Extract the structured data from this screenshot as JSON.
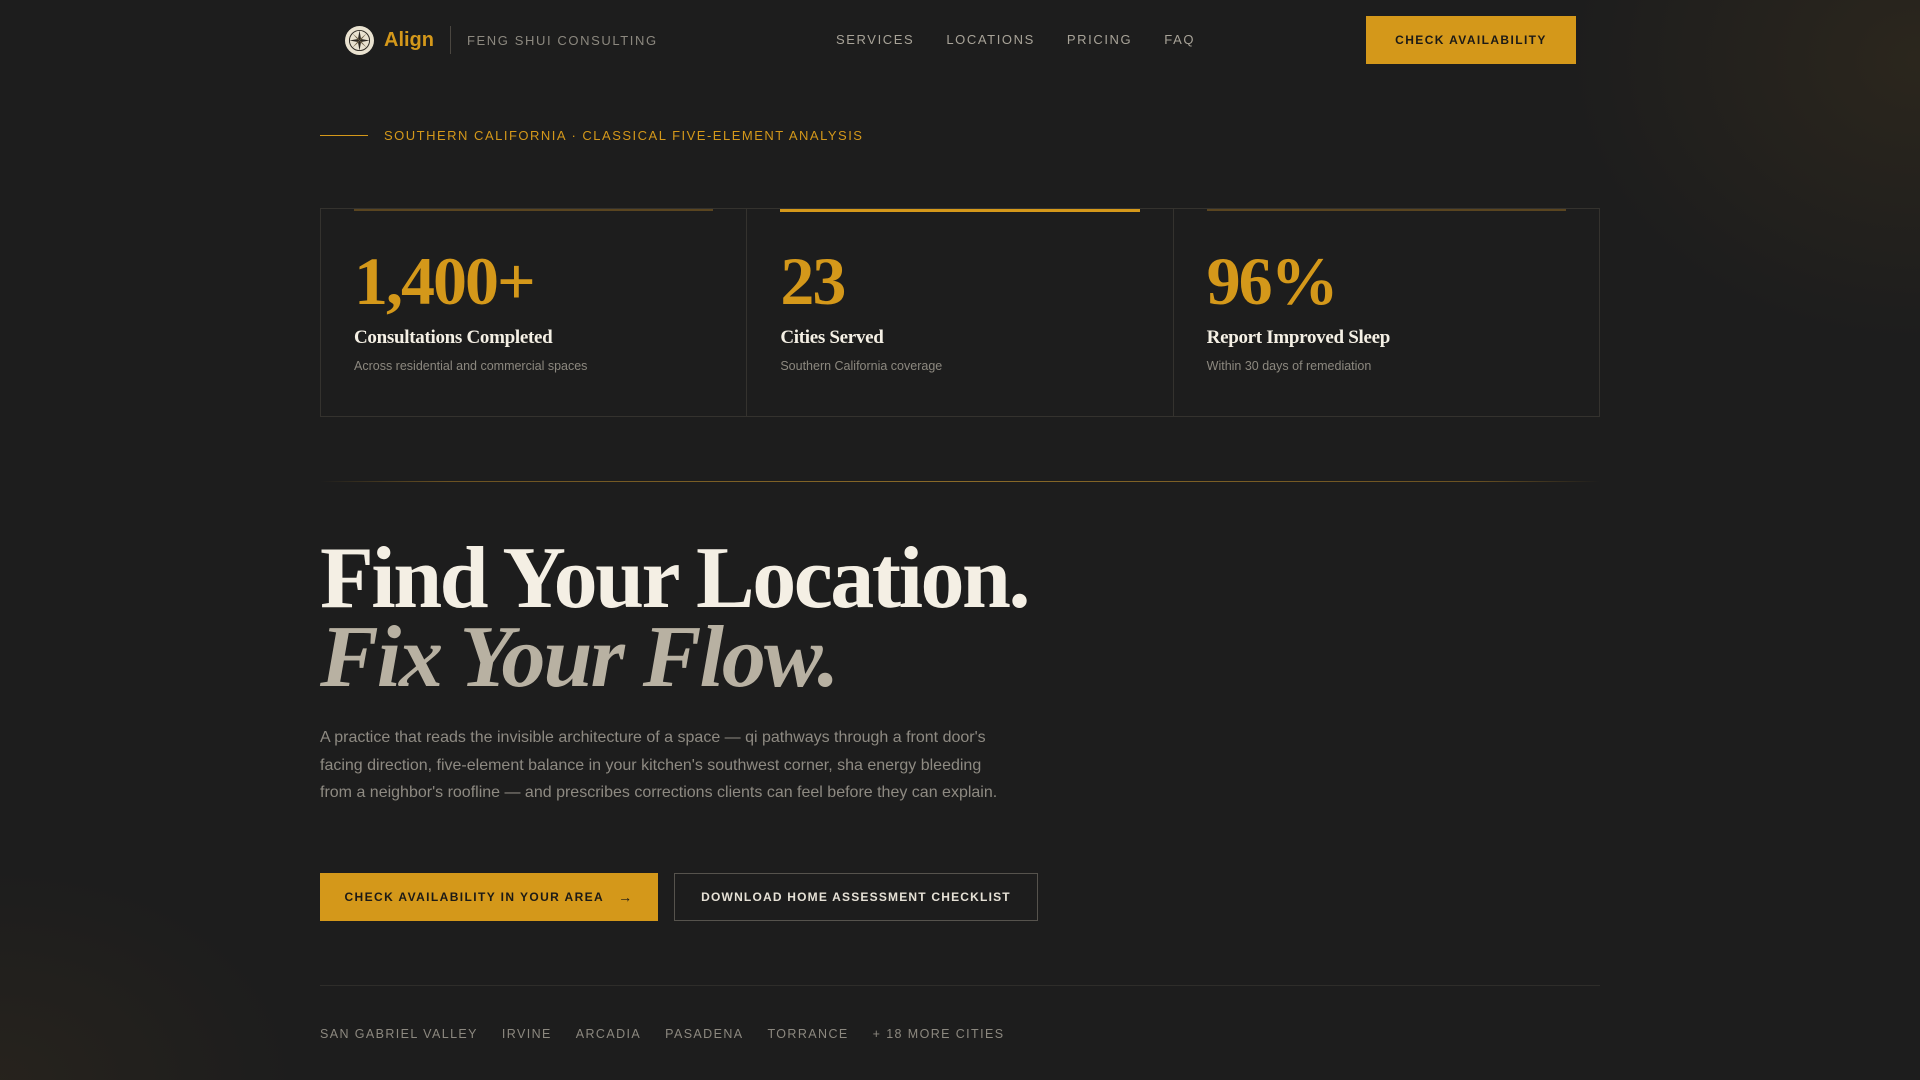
{
  "nav": {
    "brand_name": "Align",
    "brand_tag": "FENG SHUI CONSULTING",
    "links": [
      "SERVICES",
      "LOCATIONS",
      "PRICING",
      "FAQ"
    ],
    "cta": "CHECK AVAILABILITY",
    "logo_icon": "compass-rose-icon"
  },
  "eyebrow": "SOUTHERN CALIFORNIA · CLASSICAL FIVE-ELEMENT ANALYSIS",
  "stats": [
    {
      "value": "1,400+",
      "label": "Consultations Completed",
      "sub": "Across residential and commercial spaces"
    },
    {
      "value": "23",
      "label": "Cities Served",
      "sub": "Southern California coverage"
    },
    {
      "value": "96%",
      "label": "Report Improved Sleep",
      "sub": "Within 30 days of remediation"
    }
  ],
  "hero": {
    "title": "Find Your Location.",
    "subtitle": "Fix Your Flow.",
    "body": "A practice that reads the invisible architecture of a space — qi pathways through a front door's facing direction, five-element balance in your kitchen's southwest corner, sha energy bleeding from a neighbor's roofline — and prescribes corrections clients can feel before they can explain.",
    "primary_cta": "CHECK AVAILABILITY IN YOUR AREA",
    "primary_arrow": "→",
    "secondary_cta": "DOWNLOAD HOME ASSESSMENT CHECKLIST"
  },
  "cities": [
    "SAN GABRIEL VALLEY",
    "IRVINE",
    "ARCADIA",
    "PASADENA",
    "TORRANCE",
    "+ 18 MORE CITIES"
  ],
  "colors": {
    "accent": "#d4981a",
    "background": "#1d1d1d",
    "text": "#f4efe4",
    "muted": "#8c887f"
  }
}
